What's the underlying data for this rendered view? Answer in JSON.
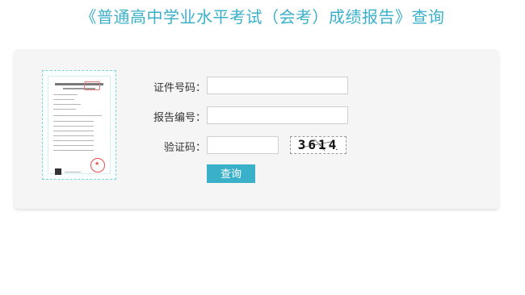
{
  "header": {
    "title": "《普通高中学业水平考试（会考）成绩报告》查询"
  },
  "form": {
    "id_label": "证件号码：",
    "id_value": "",
    "report_label": "报告编号：",
    "report_value": "",
    "captcha_label": "验证码：",
    "captcha_value": "",
    "captcha_image_text": "3614",
    "submit_label": "查询"
  },
  "colors": {
    "accent": "#3bb0c9",
    "panel": "#f5f5f5"
  }
}
